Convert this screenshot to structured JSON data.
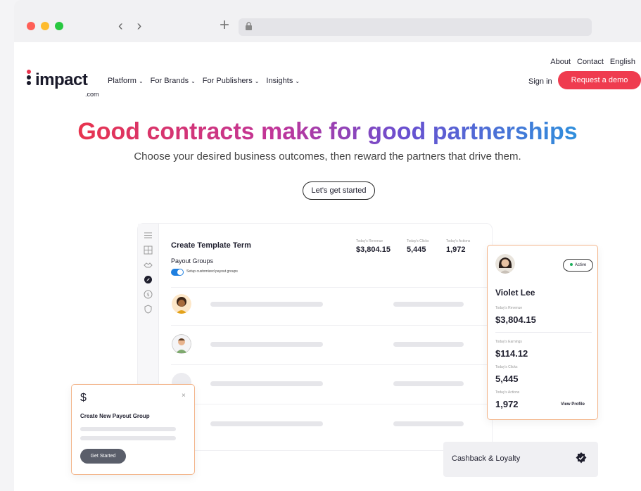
{
  "browser": {
    "dots": [
      "#ff5f57",
      "#febc2e",
      "#28c840"
    ],
    "back_icon": "chevron-left-icon",
    "forward_icon": "chevron-right-icon",
    "new_tab_icon": "plus-icon",
    "lock_icon": "lock-icon"
  },
  "header": {
    "top_links": [
      "About",
      "Contact",
      "English"
    ],
    "logo": {
      "word": "impact",
      "suffix": ".com"
    },
    "nav": [
      "Platform",
      "For Brands",
      "For Publishers",
      "Insights"
    ],
    "sign_in": "Sign in",
    "demo_button": "Request a demo",
    "accent": "#ef3b4f"
  },
  "hero": {
    "title": "Good contracts make for good partnerships",
    "subtitle": "Choose your desired business outcomes, then reward the partners that drive them.",
    "cta": "Let's get started"
  },
  "dashboard": {
    "title": "Create Template Term",
    "payout_groups": "Payout Groups",
    "toggle_label": "Setup customized payout groups",
    "stats": [
      {
        "label": "Today's Revenue",
        "value": "$3,804.15"
      },
      {
        "label": "Today's Clicks",
        "value": "5,445"
      },
      {
        "label": "Today's Actions",
        "value": "1,972"
      }
    ]
  },
  "profile": {
    "status": "Active",
    "name": "Violet Lee",
    "revenue_label": "Today's Revenue",
    "revenue": "$3,804.15",
    "earnings_label": "Today's Earnings",
    "earnings": "$114.12",
    "clicks_label": "Today's Clicks",
    "clicks": "5,445",
    "actions_label": "Today's Actions",
    "actions": "1,972",
    "view_profile": "View Profile"
  },
  "payout_card": {
    "icon": "$",
    "close": "×",
    "title": "Create New Payout Group",
    "button": "Get Started"
  },
  "cashback": {
    "label": "Cashback & Loyalty",
    "icon": "badge-check-icon"
  }
}
